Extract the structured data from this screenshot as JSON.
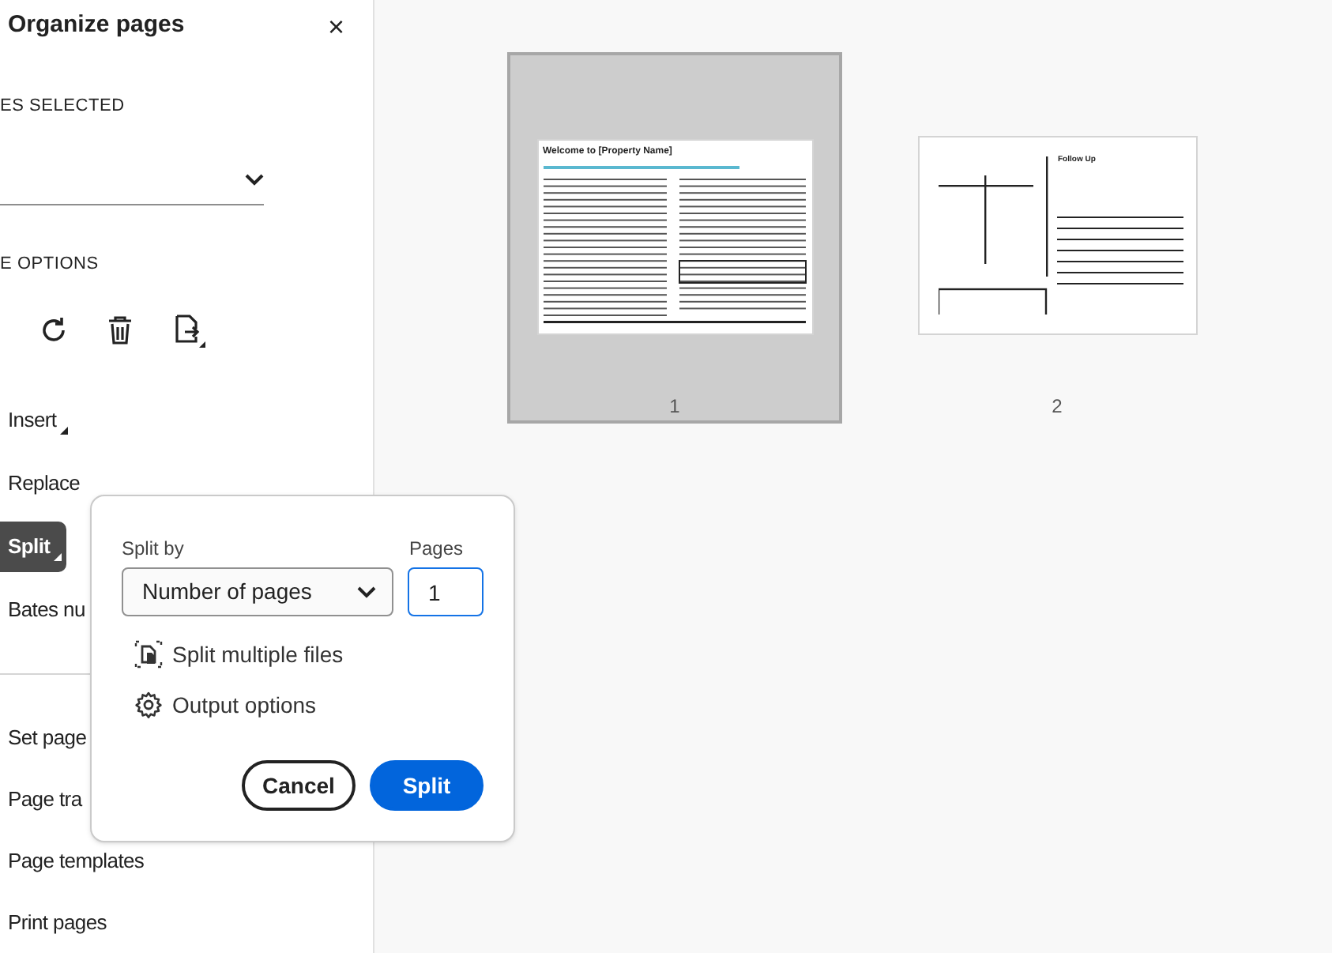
{
  "panel": {
    "title": "Organize pages",
    "close": "×",
    "selected_heading": "ES SELECTED",
    "options_heading": "E OPTIONS"
  },
  "items": [
    {
      "label": "Insert",
      "has_menu": true,
      "selected": false
    },
    {
      "label": "Replace",
      "has_menu": false,
      "selected": false
    },
    {
      "label": "Split",
      "has_menu": true,
      "selected": true
    },
    {
      "label": "Bates nu",
      "has_menu": false,
      "selected": false
    }
  ],
  "more_items": [
    {
      "label": "Set page",
      "selected": false
    },
    {
      "label": "Page tra",
      "selected": false
    },
    {
      "label": "Page templates",
      "selected": false
    },
    {
      "label": "Print pages",
      "selected": false
    }
  ],
  "dialog": {
    "split_by_label": "Split by",
    "split_by_value": "Number of pages",
    "pages_label": "Pages",
    "pages_value": "1",
    "options": [
      {
        "kind": "files",
        "label": "Split multiple files"
      },
      {
        "kind": "gear",
        "label": "Output options"
      }
    ],
    "buttons": [
      {
        "kind": "secondary",
        "label": "Cancel"
      },
      {
        "kind": "primary",
        "label": "Split"
      }
    ]
  },
  "pages": [
    {
      "kind": "form",
      "number": "1",
      "title": "Welcome to [Property Name]",
      "selected": true
    },
    {
      "kind": "followup",
      "number": "2",
      "title": "Follow Up",
      "selected": false
    }
  ]
}
